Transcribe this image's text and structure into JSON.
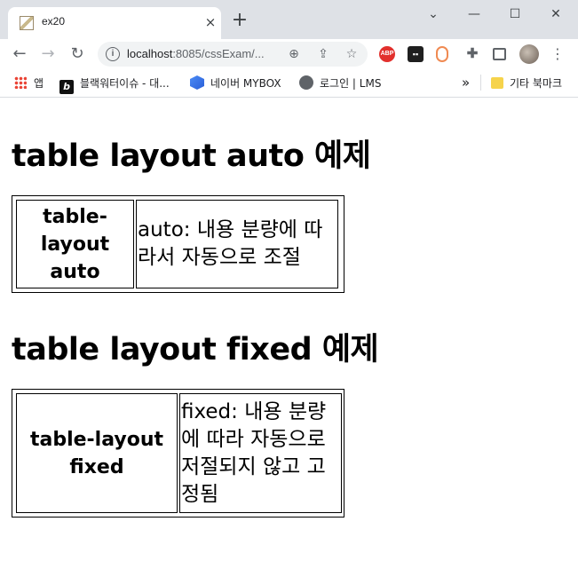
{
  "browser": {
    "tab_title": "ex20",
    "tab_close": "×",
    "new_tab": "+",
    "url_host": "localhost",
    "url_rest": ":8085/cssExam/...",
    "window_controls": {
      "minimize": "⌄",
      "restore": "—",
      "maximize": "☐",
      "close": "✕"
    }
  },
  "bookmarks": {
    "apps": "앱",
    "items": [
      {
        "label": "블랙워터이슈 - 대...",
        "icon": "b-logo-icon"
      },
      {
        "label": "네이버 MYBOX",
        "icon": "mybox-icon"
      },
      {
        "label": "로그인 | LMS",
        "icon": "globe-icon"
      }
    ],
    "overflow": "»",
    "other": "기타 북마크"
  },
  "page": {
    "heading_auto": "table layout auto 예제",
    "table_auto": {
      "header": "table-layout auto",
      "cell": "auto: 내용 분량에 따라서 자동으로 조절"
    },
    "heading_fixed": "table layout fixed 예제",
    "table_fixed": {
      "header": "table-layout fixed",
      "cell": "fixed: 내용 분량에 따라 자동으로 저절되지 않고 고정됨"
    }
  }
}
